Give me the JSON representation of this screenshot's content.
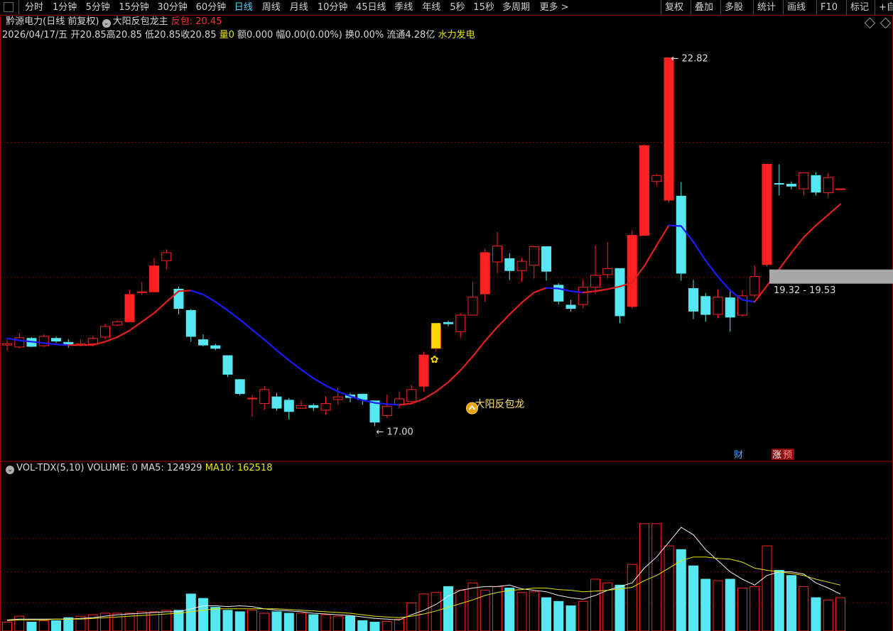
{
  "toolbar": {
    "periods": [
      "分时",
      "1分钟",
      "5分钟",
      "15分钟",
      "30分钟",
      "60分钟",
      "日线",
      "周线",
      "月线",
      "10分钟",
      "45日线",
      "季线",
      "年线",
      "5秒",
      "15秒",
      "多周期",
      "更多 >"
    ],
    "active_period": "日线",
    "right_buttons": [
      "复权",
      "叠加",
      "多股",
      "统计",
      "画线",
      "F10",
      "标记",
      "+自"
    ]
  },
  "title": {
    "stock_name": "黔源电力",
    "mode": "(日线 前复权)",
    "indicator": "大阳反包龙主",
    "indicator_value_label": "反包: 20.45"
  },
  "info": {
    "date": "2026/04/17/五",
    "open": "开20.85",
    "high": "高20.85",
    "low": "低20.85",
    "close": "收20.85",
    "volume": "量0",
    "amount": "额0.000",
    "range": "幅0.00(0.00%)",
    "turnover": "换0.00%",
    "float": "流通4.28亿",
    "concept": "水力发电"
  },
  "volume_header": {
    "name": "VOL-TDX(5,10)",
    "volume": "VOLUME: 0",
    "ma5": "MA5: 124929",
    "ma10": "MA10: 162518"
  },
  "annotations": {
    "max_label": "22.82",
    "min_label": "17.00",
    "signal_label": "大阳反包龙",
    "zone_label": "19.32 - 19.53",
    "badge_cai": "财",
    "badge_zhang": "涨",
    "badge_yu": "预"
  },
  "colors": {
    "up": "#ff2020",
    "down": "#55e8f0",
    "ma_up": "#e02020",
    "ma_down": "#1a1aff",
    "signal": "#ffd700"
  },
  "chart_data": {
    "type": "candlestick",
    "price_range": [
      16.75,
      23.05
    ],
    "volume_range": [
      0,
      210000
    ],
    "candles": [
      {
        "o": 18.5,
        "h": 18.58,
        "l": 18.42,
        "c": 18.52
      },
      {
        "o": 18.47,
        "h": 18.68,
        "l": 18.45,
        "c": 18.61
      },
      {
        "o": 18.6,
        "h": 18.62,
        "l": 18.47,
        "c": 18.48
      },
      {
        "o": 18.49,
        "h": 18.66,
        "l": 18.47,
        "c": 18.63
      },
      {
        "o": 18.6,
        "h": 18.63,
        "l": 18.53,
        "c": 18.56
      },
      {
        "o": 18.54,
        "h": 18.59,
        "l": 18.46,
        "c": 18.5
      },
      {
        "o": 18.5,
        "h": 18.58,
        "l": 18.48,
        "c": 18.52
      },
      {
        "o": 18.52,
        "h": 18.64,
        "l": 18.48,
        "c": 18.6
      },
      {
        "o": 18.62,
        "h": 18.82,
        "l": 18.58,
        "c": 18.78
      },
      {
        "o": 18.8,
        "h": 18.88,
        "l": 18.78,
        "c": 18.85
      },
      {
        "o": 18.85,
        "h": 19.33,
        "l": 18.85,
        "c": 19.26
      },
      {
        "o": 19.29,
        "h": 19.45,
        "l": 19.25,
        "c": 19.3
      },
      {
        "o": 19.3,
        "h": 19.81,
        "l": 19.3,
        "c": 19.69
      },
      {
        "o": 19.77,
        "h": 19.94,
        "l": 19.64,
        "c": 19.89
      },
      {
        "o": 19.34,
        "h": 19.38,
        "l": 18.96,
        "c": 19.05
      },
      {
        "o": 19.02,
        "h": 19.04,
        "l": 18.55,
        "c": 18.63
      },
      {
        "o": 18.58,
        "h": 18.66,
        "l": 18.48,
        "c": 18.5
      },
      {
        "o": 18.49,
        "h": 18.52,
        "l": 18.42,
        "c": 18.45
      },
      {
        "o": 18.34,
        "h": 18.34,
        "l": 18.02,
        "c": 18.06
      },
      {
        "o": 17.98,
        "h": 17.99,
        "l": 17.74,
        "c": 17.77
      },
      {
        "o": 17.7,
        "h": 17.75,
        "l": 17.42,
        "c": 17.7
      },
      {
        "o": 17.62,
        "h": 17.88,
        "l": 17.52,
        "c": 17.83
      },
      {
        "o": 17.72,
        "h": 17.78,
        "l": 17.51,
        "c": 17.55
      },
      {
        "o": 17.67,
        "h": 17.7,
        "l": 17.38,
        "c": 17.5
      },
      {
        "o": 17.55,
        "h": 17.67,
        "l": 17.54,
        "c": 17.59
      },
      {
        "o": 17.59,
        "h": 17.62,
        "l": 17.51,
        "c": 17.56
      },
      {
        "o": 17.52,
        "h": 17.73,
        "l": 17.45,
        "c": 17.62
      },
      {
        "o": 17.68,
        "h": 17.86,
        "l": 17.6,
        "c": 17.72
      },
      {
        "o": 17.75,
        "h": 17.78,
        "l": 17.64,
        "c": 17.71
      },
      {
        "o": 17.76,
        "h": 17.77,
        "l": 17.6,
        "c": 17.68
      },
      {
        "o": 17.66,
        "h": 17.66,
        "l": 17.28,
        "c": 17.34
      },
      {
        "o": 17.44,
        "h": 17.75,
        "l": 17.4,
        "c": 17.58
      },
      {
        "o": 17.6,
        "h": 17.8,
        "l": 17.55,
        "c": 17.69
      },
      {
        "o": 17.65,
        "h": 17.9,
        "l": 17.63,
        "c": 17.83
      },
      {
        "o": 17.88,
        "h": 18.4,
        "l": 17.8,
        "c": 18.35
      },
      {
        "o": 18.45,
        "h": 18.8,
        "l": 18.4,
        "c": 18.78
      },
      {
        "o": 18.84,
        "h": 18.87,
        "l": 18.78,
        "c": 18.82
      },
      {
        "o": 18.7,
        "h": 18.98,
        "l": 18.6,
        "c": 18.95
      },
      {
        "o": 18.95,
        "h": 19.45,
        "l": 18.95,
        "c": 19.22
      },
      {
        "o": 19.27,
        "h": 19.95,
        "l": 19.15,
        "c": 19.89
      },
      {
        "o": 19.75,
        "h": 20.2,
        "l": 19.58,
        "c": 19.99
      },
      {
        "o": 19.8,
        "h": 19.88,
        "l": 19.48,
        "c": 19.62
      },
      {
        "o": 19.62,
        "h": 19.81,
        "l": 19.45,
        "c": 19.76
      },
      {
        "o": 19.7,
        "h": 19.99,
        "l": 19.5,
        "c": 19.98
      },
      {
        "o": 19.98,
        "h": 19.98,
        "l": 19.47,
        "c": 19.61
      },
      {
        "o": 19.4,
        "h": 19.43,
        "l": 19.11,
        "c": 19.16
      },
      {
        "o": 19.1,
        "h": 19.18,
        "l": 19.0,
        "c": 19.05
      },
      {
        "o": 19.11,
        "h": 19.48,
        "l": 19.05,
        "c": 19.37
      },
      {
        "o": 19.37,
        "h": 20.0,
        "l": 19.27,
        "c": 19.55
      },
      {
        "o": 19.56,
        "h": 20.05,
        "l": 19.5,
        "c": 19.65
      },
      {
        "o": 19.65,
        "h": 19.65,
        "l": 18.83,
        "c": 18.94
      },
      {
        "o": 19.08,
        "h": 20.22,
        "l": 19.05,
        "c": 20.15
      },
      {
        "o": 20.15,
        "h": 21.52,
        "l": 20.15,
        "c": 21.5
      },
      {
        "o": 20.96,
        "h": 21.08,
        "l": 20.9,
        "c": 21.05
      },
      {
        "o": 20.68,
        "h": 22.82,
        "l": 20.65,
        "c": 22.82
      },
      {
        "o": 20.74,
        "h": 20.95,
        "l": 19.47,
        "c": 19.58
      },
      {
        "o": 19.35,
        "h": 19.48,
        "l": 18.89,
        "c": 19.01
      },
      {
        "o": 19.23,
        "h": 19.28,
        "l": 18.85,
        "c": 18.96
      },
      {
        "o": 18.96,
        "h": 19.34,
        "l": 18.9,
        "c": 19.22
      },
      {
        "o": 19.21,
        "h": 19.34,
        "l": 18.7,
        "c": 18.92
      },
      {
        "o": 18.95,
        "h": 19.32,
        "l": 18.93,
        "c": 19.24
      },
      {
        "o": 19.25,
        "h": 19.7,
        "l": 19.22,
        "c": 19.53
      },
      {
        "o": 19.71,
        "h": 21.22,
        "l": 19.68,
        "c": 21.22
      },
      {
        "o": 20.93,
        "h": 21.22,
        "l": 20.75,
        "c": 20.92
      },
      {
        "o": 20.92,
        "h": 20.96,
        "l": 20.84,
        "c": 20.89
      },
      {
        "o": 20.85,
        "h": 21.07,
        "l": 20.75,
        "c": 21.09
      },
      {
        "o": 21.05,
        "h": 21.1,
        "l": 20.75,
        "c": 20.8
      },
      {
        "o": 20.79,
        "h": 21.09,
        "l": 20.71,
        "c": 21.02
      },
      {
        "o": 20.85,
        "h": 20.85,
        "l": 20.85,
        "c": 20.85
      }
    ],
    "volumes": [
      12000,
      20000,
      12000,
      14000,
      14000,
      18000,
      20000,
      22000,
      24000,
      24000,
      24000,
      26000,
      26000,
      28000,
      28000,
      50000,
      44000,
      32000,
      28000,
      26000,
      28000,
      24000,
      26000,
      24000,
      24000,
      22000,
      22000,
      20000,
      20000,
      14000,
      12000,
      13000,
      16000,
      38000,
      50000,
      52000,
      60000,
      55000,
      65000,
      55000,
      60000,
      58000,
      52000,
      53000,
      45000,
      40000,
      34000,
      40000,
      70000,
      65000,
      62000,
      90000,
      145000,
      145000,
      115000,
      110000,
      88000,
      70000,
      68000,
      70000,
      58000,
      60000,
      115000,
      82000,
      75000,
      60000,
      45000,
      42000,
      45000
    ],
    "ma_price": [
      18.6,
      18.57,
      18.55,
      18.53,
      18.51,
      18.5,
      18.5,
      18.5,
      18.55,
      18.62,
      18.72,
      18.85,
      18.98,
      19.15,
      19.31,
      19.32,
      19.26,
      19.15,
      19.02,
      18.88,
      18.73,
      18.58,
      18.42,
      18.27,
      18.13,
      18.0,
      17.89,
      17.8,
      17.73,
      17.67,
      17.63,
      17.61,
      17.6,
      17.62,
      17.69,
      17.8,
      17.94,
      18.12,
      18.33,
      18.56,
      18.77,
      18.96,
      19.14,
      19.29,
      19.36,
      19.35,
      19.31,
      19.29,
      19.31,
      19.34,
      19.38,
      19.44,
      19.69,
      20.0,
      20.3,
      20.29,
      20.05,
      19.77,
      19.53,
      19.32,
      19.18,
      19.15,
      19.39,
      19.64,
      19.89,
      20.12,
      20.3,
      20.46,
      20.62
    ],
    "ma5_vol": [
      15000,
      16000,
      16000,
      16000,
      16000,
      16000,
      17000,
      18000,
      20000,
      22000,
      23000,
      24000,
      25000,
      26000,
      26000,
      30000,
      34000,
      34000,
      33000,
      34000,
      33000,
      30000,
      28000,
      27000,
      26000,
      24000,
      23000,
      22000,
      21000,
      19000,
      17000,
      16000,
      15000,
      22000,
      28000,
      36000,
      47000,
      55000,
      58000,
      60000,
      60000,
      62000,
      57000,
      55000,
      53000,
      48000,
      45000,
      43000,
      48000,
      55000,
      60000,
      65000,
      85000,
      100000,
      120000,
      140000,
      130000,
      110000,
      95000,
      80000,
      70000,
      62000,
      75000,
      80000,
      80000,
      77000,
      65000,
      58000,
      50000
    ],
    "ma10_vol": [
      14000,
      15000,
      15000,
      15000,
      16000,
      16000,
      16000,
      17000,
      18000,
      19000,
      20000,
      21000,
      22000,
      23000,
      24000,
      26000,
      28000,
      30000,
      30000,
      30000,
      30000,
      30000,
      30000,
      29000,
      28000,
      27000,
      26000,
      25000,
      24000,
      22000,
      20000,
      19000,
      18000,
      20000,
      23000,
      27000,
      32000,
      37000,
      42000,
      48000,
      52000,
      55000,
      56000,
      58000,
      58000,
      56000,
      55000,
      53000,
      54000,
      55000,
      57000,
      59000,
      68000,
      75000,
      85000,
      95000,
      100000,
      100000,
      98000,
      97000,
      93000,
      85000,
      82000,
      80000,
      78000,
      75000,
      70000,
      66000,
      62000
    ]
  }
}
